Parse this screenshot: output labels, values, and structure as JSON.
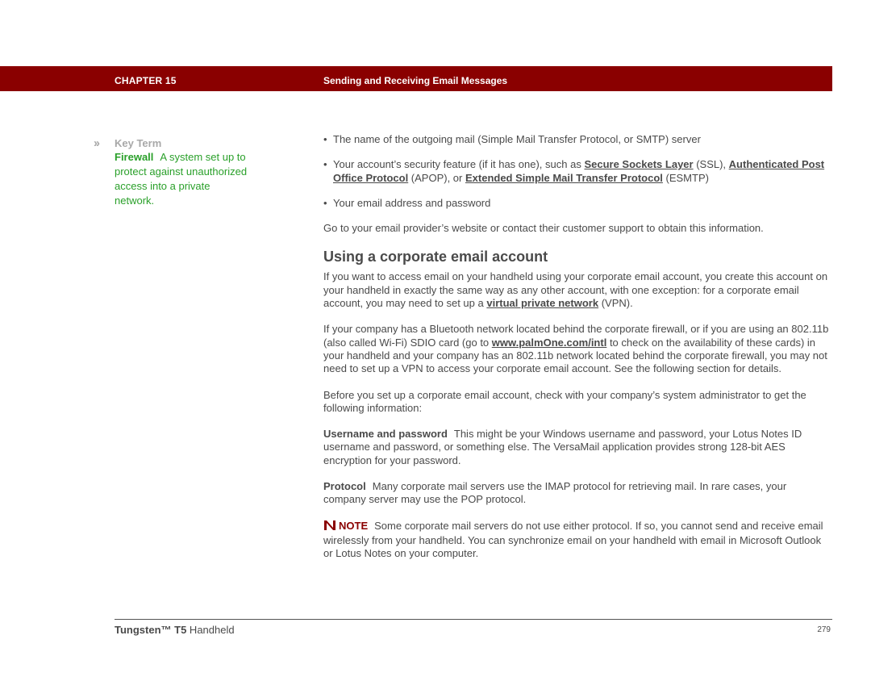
{
  "header": {
    "chapter": "CHAPTER 15",
    "title": "Sending and Receiving Email Messages",
    "bar_color": "#8a0000"
  },
  "sidebar": {
    "icon": "double-chevron-icon",
    "heading": "Key Term",
    "term": "Firewall",
    "definition": "A system set up to protect against unauthorized access into a private network.",
    "color": "#2aa02a"
  },
  "main": {
    "bullets": [
      {
        "text": "The name of the outgoing mail (Simple Mail Transfer Protocol, or SMTP) server"
      },
      {
        "pre": "Your account’s security feature (if it has one), such as ",
        "link1": "Secure Sockets Layer",
        "mid1": " (SSL), ",
        "link2": "Authenticated Post Office Protocol",
        "mid2": " (APOP), or ",
        "link3": "Extended Simple Mail Transfer Protocol",
        "post": " (ESMTP)"
      },
      {
        "text": "Your email address and password"
      }
    ],
    "para_provider": "Go to your email provider’s website or contact their customer support to obtain this information.",
    "section_heading": "Using a corporate email account",
    "para1": {
      "pre": "If you want to access email on your handheld using your corporate email account, you create this account on your handheld in exactly the same way as any other account, with one exception: for a corporate email account, you may need to set up a ",
      "link": "virtual private network",
      "post": " (VPN)."
    },
    "para2": {
      "pre": "If your company has a Bluetooth network located behind the corporate firewall, or if you are using an 802.11b (also called Wi-Fi) SDIO card (go to ",
      "link": "www.palmOne.com/intl",
      "post": " to check on the availability of these cards) in your handheld and your company has an 802.11b network located behind the corporate firewall, you may not need to set up a VPN to access your corporate email account. See the following section for details."
    },
    "para3": "Before you set up a corporate email account, check with your company’s system administrator to get the following information:",
    "username": {
      "lead": "Username and password",
      "text": "This might be your Windows username and password, your Lotus Notes ID username and password, or something else. The VersaMail application provides strong 128-bit AES encryption for your password."
    },
    "protocol": {
      "lead": "Protocol",
      "text": "Many corporate mail servers use the IMAP protocol for retrieving mail. In rare cases, your company server may use the POP protocol."
    },
    "note": {
      "icon": "note-icon",
      "label": "NOTE",
      "text": "Some corporate mail servers do not use either protocol. If so, you cannot send and receive email wirelessly from your handheld. You can synchronize email on your handheld with email in Microsoft Outlook or Lotus Notes on your computer.",
      "color": "#8a0000"
    }
  },
  "footer": {
    "brand": "Tungsten™ T5",
    "product": " Handheld",
    "page": "279"
  }
}
